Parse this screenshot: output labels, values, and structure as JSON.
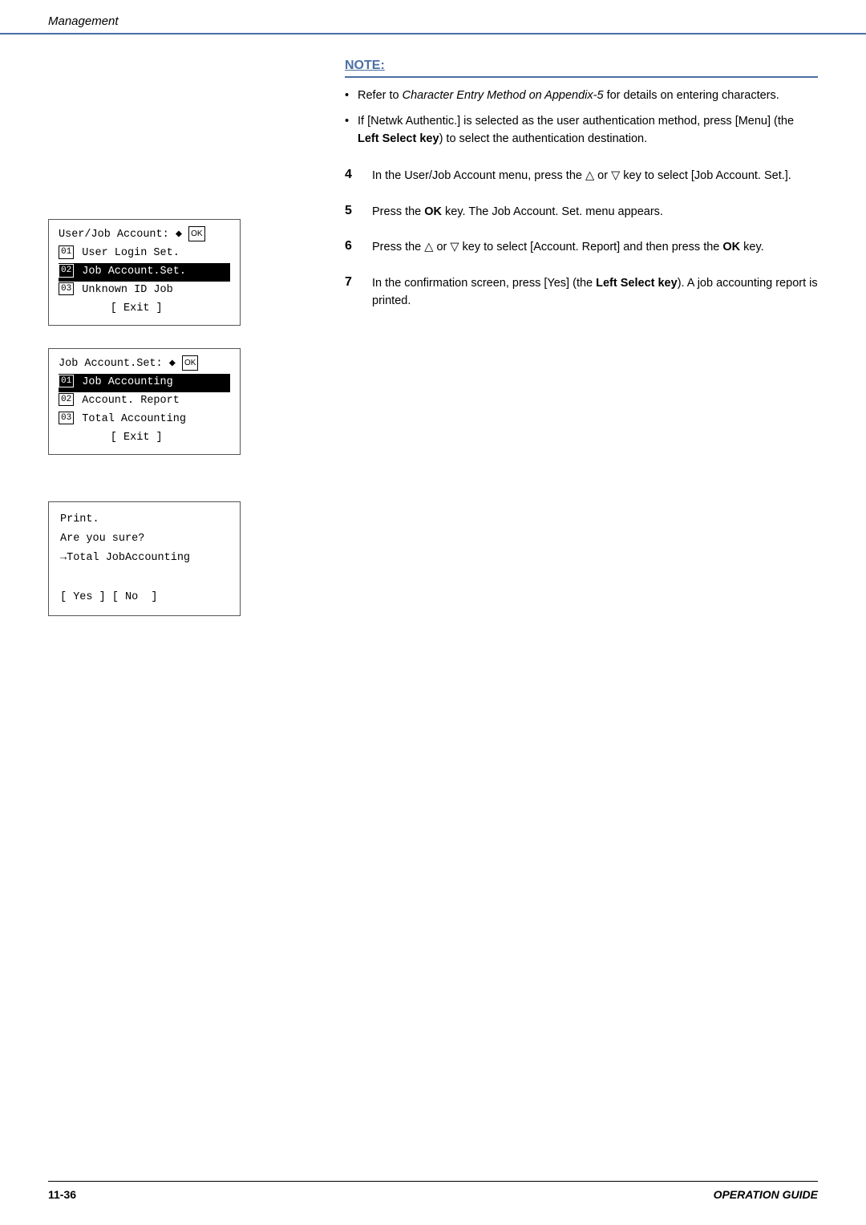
{
  "header": {
    "title": "Management"
  },
  "footer": {
    "page": "11-36",
    "guide": "OPERATION GUIDE"
  },
  "note": {
    "title": "NOTE:",
    "bullets": [
      "Refer to <i>Character Entry Method on Appendix-5</i> for details on entering characters.",
      "If [Netwk Authentic.] is selected as the user authentication method, press [Menu] (the <b>Left Select key</b>) to select the authentication destination."
    ]
  },
  "steps": [
    {
      "number": "4",
      "text": "In the User/Job Account menu, press the △ or ▽ key to select [Job Account. Set.]."
    },
    {
      "number": "5",
      "text": "Press the <b>OK</b> key. The Job Account. Set. menu appears."
    },
    {
      "number": "6",
      "text": "Press the △ or ▽ key to select [Account. Report] and then press the <b>OK</b> key."
    },
    {
      "number": "7",
      "text": "In the confirmation screen, press [Yes] (the <b>Left Select key</b>). A job accounting report is printed."
    }
  ],
  "screen1": {
    "title": "User/Job Account: ♢",
    "ok_badge": "OK",
    "items": [
      {
        "num": "01",
        "text": "User Login Set.",
        "highlighted": false
      },
      {
        "num": "02",
        "text": "Job Account.Set.",
        "highlighted": true
      },
      {
        "num": "03",
        "text": "Unknown ID Job",
        "highlighted": false
      }
    ],
    "exit": "[ Exit ]"
  },
  "screen2": {
    "title": "Job Account.Set: ♢",
    "ok_badge": "OK",
    "items": [
      {
        "num": "01",
        "text": "Job Accounting",
        "highlighted": true
      },
      {
        "num": "02",
        "text": "Account. Report",
        "highlighted": false
      },
      {
        "num": "03",
        "text": "Total Accounting",
        "highlighted": false
      }
    ],
    "exit": "[ Exit ]"
  },
  "screen3": {
    "lines": [
      "Print.",
      "Are you sure?",
      "→Total JobAccounting",
      "",
      "[ Yes ] [ No  ]"
    ]
  }
}
